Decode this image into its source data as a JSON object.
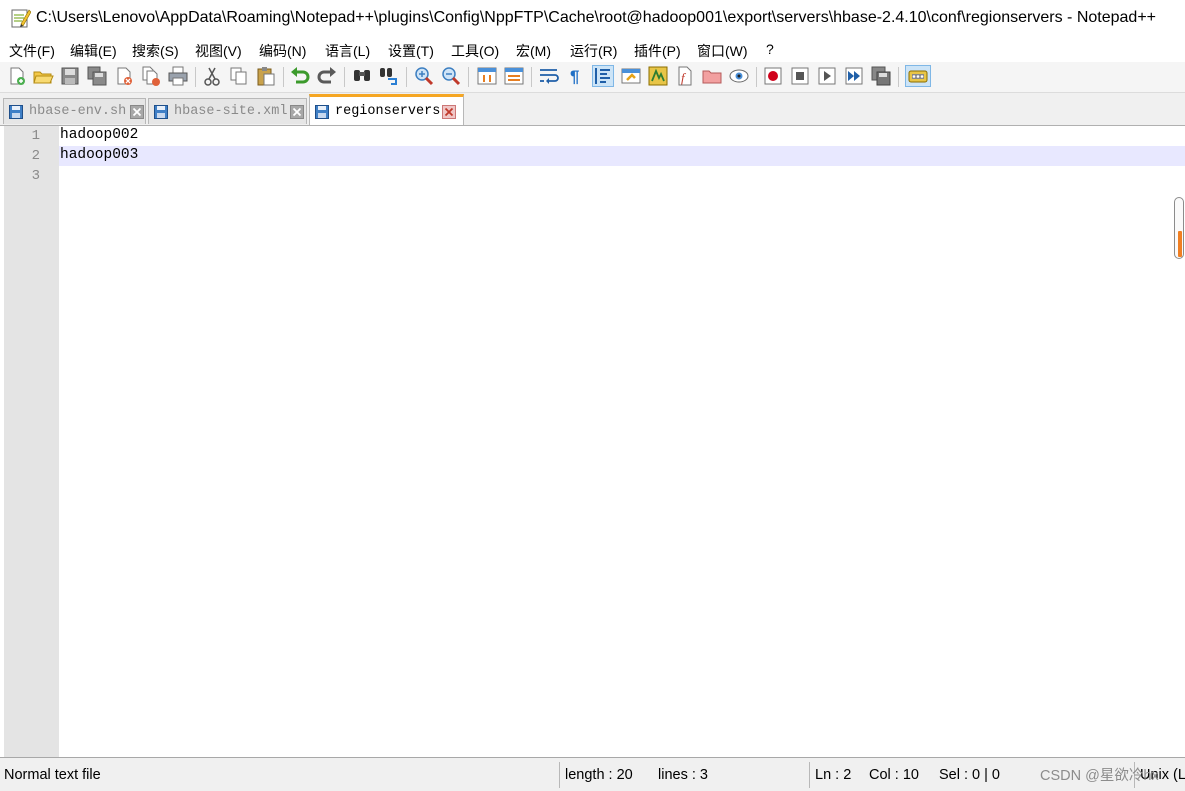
{
  "window": {
    "title": "C:\\Users\\Lenovo\\AppData\\Roaming\\Notepad++\\plugins\\Config\\NppFTP\\Cache\\root@hadoop001\\export\\servers\\hbase-2.4.10\\conf\\regionservers - Notepad++"
  },
  "menu": {
    "items": [
      "文件(F)",
      "编辑(E)",
      "搜索(S)",
      "视图(V)",
      "编码(N)",
      "语言(L)",
      "设置(T)",
      "工具(O)",
      "宏(M)",
      "运行(R)",
      "插件(P)",
      "窗口(W)",
      "?"
    ]
  },
  "tabs": [
    {
      "label": "hbase-env.sh",
      "active": false
    },
    {
      "label": "hbase-site.xml",
      "active": false
    },
    {
      "label": "regionservers",
      "active": true
    }
  ],
  "editor": {
    "lines": [
      {
        "number": "1",
        "text": "hadoop002"
      },
      {
        "number": "2",
        "text": "hadoop003"
      },
      {
        "number": "3",
        "text": ""
      }
    ],
    "current_line": 2
  },
  "status": {
    "file_type": "Normal text file",
    "length": "length : 20",
    "lines": "lines : 3",
    "ln": "Ln : 2",
    "col": "Col : 10",
    "sel": "Sel : 0 | 0",
    "eol": "Unix (LF)",
    "watermark": "CSDN @星欲冷hx"
  },
  "colors": {
    "current_line": "#e8e8ff",
    "active_tab_accent": "#f5a623",
    "gutter": "#e4e4e4",
    "toolbar_active": "#cce4f7"
  },
  "toolbar": {
    "icons": [
      "new-file-icon",
      "open-file-icon",
      "save-icon",
      "save-all-icon",
      "close-icon",
      "close-all-icon",
      "print-icon",
      "cut-icon",
      "copy-icon",
      "paste-icon",
      "undo-icon",
      "redo-icon",
      "find-icon",
      "replace-icon",
      "zoom-in-icon",
      "zoom-out-icon",
      "sync-vertical-icon",
      "sync-horizontal-icon",
      "word-wrap-icon",
      "show-all-chars-icon",
      "indent-guide-icon",
      "udl-icon",
      "doc-map-icon",
      "function-list-icon",
      "folder-workspace-icon",
      "monitor-icon",
      "macro-record-icon",
      "macro-stop-icon",
      "macro-play-icon",
      "macro-run-multiple-icon",
      "macro-save-icon",
      "nppftp-icon"
    ]
  }
}
